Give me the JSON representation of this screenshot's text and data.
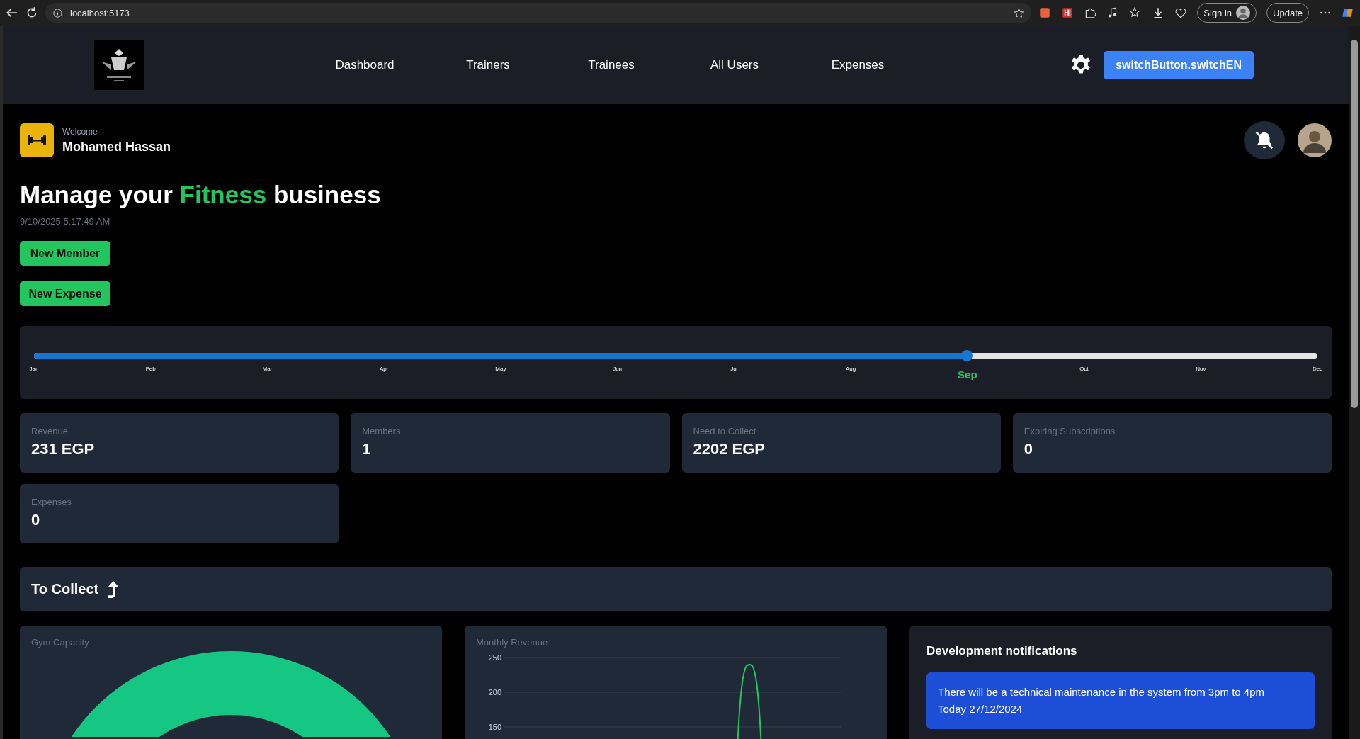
{
  "browser": {
    "url": "localhost:5173",
    "sign_in": "Sign in",
    "update": "Update"
  },
  "nav": {
    "links": [
      {
        "label": "Dashboard"
      },
      {
        "label": "Trainers"
      },
      {
        "label": "Trainees"
      },
      {
        "label": "All Users"
      },
      {
        "label": "Expenses"
      }
    ],
    "language_button": "switchButton.switchEN"
  },
  "welcome": {
    "greeting": "Welcome",
    "name": "Mohamed Hassan",
    "notifications_muted": true
  },
  "headline": {
    "before": "Manage your ",
    "highlight": "Fitness",
    "after": " business"
  },
  "datetime": "9/10/2025 5:17:49 AM",
  "actions": [
    "New Member",
    "New Expense"
  ],
  "month_slider": {
    "level": 0.727,
    "months": [
      {
        "label": "Jan",
        "selected": false
      },
      {
        "label": "Feb",
        "selected": false
      },
      {
        "label": "Mar",
        "selected": false
      },
      {
        "label": "Apr",
        "selected": false
      },
      {
        "label": "May",
        "selected": false
      },
      {
        "label": "Jun",
        "selected": false
      },
      {
        "label": "Jul",
        "selected": false
      },
      {
        "label": "Aug",
        "selected": false
      },
      {
        "label": "Sep",
        "selected": true
      },
      {
        "label": "Oct",
        "selected": false
      },
      {
        "label": "Nov",
        "selected": false
      },
      {
        "label": "Dec",
        "selected": false
      }
    ]
  },
  "stats": [
    {
      "label": "Revenue",
      "value": "231 EGP"
    },
    {
      "label": "Members",
      "value": "1"
    },
    {
      "label": "Need to Collect",
      "value": "2202 EGP"
    },
    {
      "label": "Expiring Subscriptions",
      "value": "0"
    },
    {
      "label": "Expenses",
      "value": "0"
    }
  ],
  "to_collect": {
    "title": "To Collect"
  },
  "gym_capacity": {
    "title": "Gym Capacity"
  },
  "monthly_revenue": {
    "title": "Monthly Revenue",
    "axis_labels": [
      "250",
      "200",
      "150"
    ]
  },
  "dev_notifications": {
    "title": "Development notifications",
    "messages": [
      "There will be a technical maintenance in the system from 3pm to 4pm Today 27/12/2024"
    ]
  }
}
